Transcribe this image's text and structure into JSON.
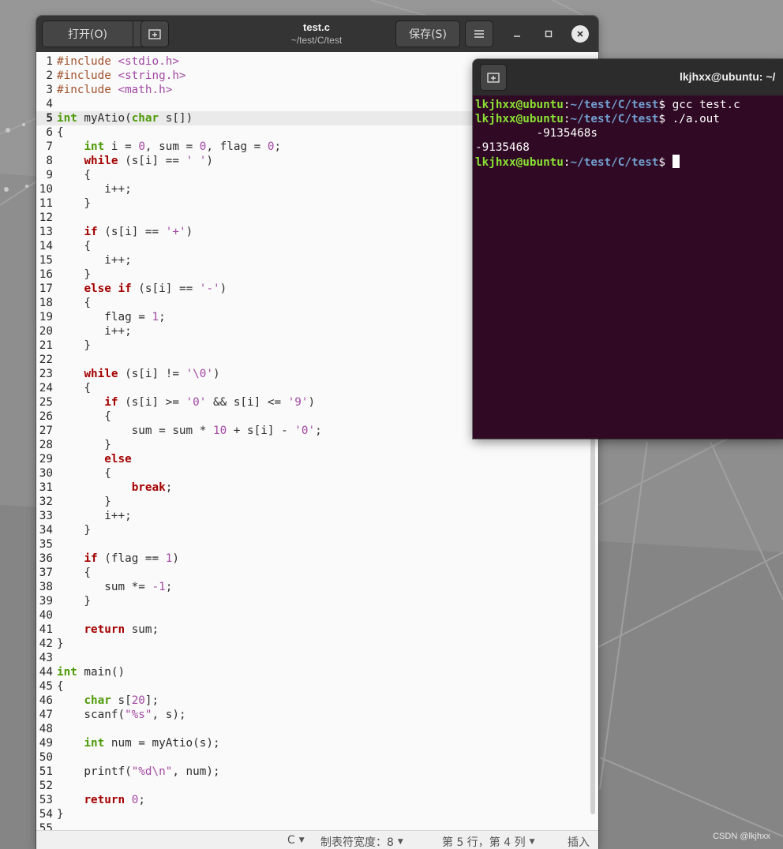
{
  "editor": {
    "title": "test.c",
    "subtitle": "~/test/C/test",
    "open_label": "打开(O)",
    "save_label": "保存(S)",
    "current_line": 5,
    "lines": [
      [
        [
          "pp",
          "#include "
        ],
        [
          "st",
          "<stdio.h>"
        ]
      ],
      [
        [
          "pp",
          "#include "
        ],
        [
          "st",
          "<string.h>"
        ]
      ],
      [
        [
          "pp",
          "#include "
        ],
        [
          "st",
          "<math.h>"
        ]
      ],
      [],
      [
        [
          "ty",
          "int"
        ],
        [
          "t",
          " myAtio("
        ],
        [
          "ty",
          "char"
        ],
        [
          "t",
          " s[])"
        ]
      ],
      [
        [
          "t",
          "{"
        ]
      ],
      [
        [
          "t",
          "    "
        ],
        [
          "ty",
          "int"
        ],
        [
          "t",
          " i = "
        ],
        [
          "nm",
          "0"
        ],
        [
          "t",
          ", sum = "
        ],
        [
          "nm",
          "0"
        ],
        [
          "t",
          ", flag = "
        ],
        [
          "nm",
          "0"
        ],
        [
          "t",
          ";"
        ]
      ],
      [
        [
          "t",
          "    "
        ],
        [
          "kw",
          "while"
        ],
        [
          "t",
          " (s[i] == "
        ],
        [
          "st",
          "' '"
        ],
        [
          "t",
          ")"
        ]
      ],
      [
        [
          "t",
          "    {"
        ]
      ],
      [
        [
          "t",
          "       i++;"
        ]
      ],
      [
        [
          "t",
          "    }"
        ]
      ],
      [],
      [
        [
          "t",
          "    "
        ],
        [
          "kw",
          "if"
        ],
        [
          "t",
          " (s[i] == "
        ],
        [
          "st",
          "'+'"
        ],
        [
          "t",
          ")"
        ]
      ],
      [
        [
          "t",
          "    {"
        ]
      ],
      [
        [
          "t",
          "       i++;"
        ]
      ],
      [
        [
          "t",
          "    }"
        ]
      ],
      [
        [
          "t",
          "    "
        ],
        [
          "kw",
          "else if"
        ],
        [
          "t",
          " (s[i] == "
        ],
        [
          "st",
          "'-'"
        ],
        [
          "t",
          ")"
        ]
      ],
      [
        [
          "t",
          "    {"
        ]
      ],
      [
        [
          "t",
          "       flag = "
        ],
        [
          "nm",
          "1"
        ],
        [
          "t",
          ";"
        ]
      ],
      [
        [
          "t",
          "       i++;"
        ]
      ],
      [
        [
          "t",
          "    }"
        ]
      ],
      [],
      [
        [
          "t",
          "    "
        ],
        [
          "kw",
          "while"
        ],
        [
          "t",
          " (s[i] != "
        ],
        [
          "st",
          "'\\0'"
        ],
        [
          "t",
          ")"
        ]
      ],
      [
        [
          "t",
          "    {"
        ]
      ],
      [
        [
          "t",
          "       "
        ],
        [
          "kw",
          "if"
        ],
        [
          "t",
          " (s[i] >= "
        ],
        [
          "st",
          "'0'"
        ],
        [
          "t",
          " && s[i] <= "
        ],
        [
          "st",
          "'9'"
        ],
        [
          "t",
          ")"
        ]
      ],
      [
        [
          "t",
          "       {"
        ]
      ],
      [
        [
          "t",
          "           sum = sum * "
        ],
        [
          "nm",
          "10"
        ],
        [
          "t",
          " + s[i] - "
        ],
        [
          "st",
          "'0'"
        ],
        [
          "t",
          ";"
        ]
      ],
      [
        [
          "t",
          "       }"
        ]
      ],
      [
        [
          "t",
          "       "
        ],
        [
          "kw",
          "else"
        ]
      ],
      [
        [
          "t",
          "       {"
        ]
      ],
      [
        [
          "t",
          "           "
        ],
        [
          "kw",
          "break"
        ],
        [
          "t",
          ";"
        ]
      ],
      [
        [
          "t",
          "       }"
        ]
      ],
      [
        [
          "t",
          "       i++;"
        ]
      ],
      [
        [
          "t",
          "    }"
        ]
      ],
      [],
      [
        [
          "t",
          "    "
        ],
        [
          "kw",
          "if"
        ],
        [
          "t",
          " (flag == "
        ],
        [
          "nm",
          "1"
        ],
        [
          "t",
          ")"
        ]
      ],
      [
        [
          "t",
          "    {"
        ]
      ],
      [
        [
          "t",
          "       sum *= "
        ],
        [
          "nm",
          "-1"
        ],
        [
          "t",
          ";"
        ]
      ],
      [
        [
          "t",
          "    }"
        ]
      ],
      [],
      [
        [
          "t",
          "    "
        ],
        [
          "kw",
          "return"
        ],
        [
          "t",
          " sum;"
        ]
      ],
      [
        [
          "t",
          "}"
        ]
      ],
      [],
      [
        [
          "ty",
          "int"
        ],
        [
          "t",
          " main()"
        ]
      ],
      [
        [
          "t",
          "{"
        ]
      ],
      [
        [
          "t",
          "    "
        ],
        [
          "ty",
          "char"
        ],
        [
          "t",
          " s["
        ],
        [
          "nm",
          "20"
        ],
        [
          "t",
          "];"
        ]
      ],
      [
        [
          "t",
          "    scanf("
        ],
        [
          "st",
          "\"%s\""
        ],
        [
          "t",
          ", s);"
        ]
      ],
      [],
      [
        [
          "t",
          "    "
        ],
        [
          "ty",
          "int"
        ],
        [
          "t",
          " num = myAtio(s);"
        ]
      ],
      [],
      [
        [
          "t",
          "    printf("
        ],
        [
          "st",
          "\"%d\\n\""
        ],
        [
          "t",
          ", num);"
        ]
      ],
      [],
      [
        [
          "t",
          "    "
        ],
        [
          "kw",
          "return"
        ],
        [
          "t",
          " "
        ],
        [
          "nm",
          "0"
        ],
        [
          "t",
          ";"
        ]
      ],
      [
        [
          "t",
          "}"
        ]
      ],
      []
    ]
  },
  "statusbar": {
    "language": "C",
    "tab_width": "制表符宽度：8",
    "position": "第 5 行，第 4 列",
    "mode": "插入"
  },
  "terminal": {
    "title": "lkjhxx@ubuntu: ~/",
    "prompt_user": "lkjhxx@ubuntu",
    "prompt_sep": ":",
    "prompt_path": "~/test/C/test",
    "prompt_dollar": "$ ",
    "lines": [
      {
        "prompt": true,
        "cmd": "gcc test.c"
      },
      {
        "prompt": true,
        "cmd": "./a.out"
      },
      {
        "prompt": false,
        "text": "         -9135468s"
      },
      {
        "prompt": false,
        "text": "-9135468"
      },
      {
        "prompt": true,
        "cmd": "",
        "cursor": true
      }
    ]
  },
  "watermark": "CSDN @lkjhxx",
  "colors": {
    "terminal_bg": "#300a24",
    "prompt_user": "#8ae234",
    "prompt_path": "#729fcf",
    "keyword": "#a40000",
    "type": "#4e9a06",
    "string": "#a349a4"
  }
}
